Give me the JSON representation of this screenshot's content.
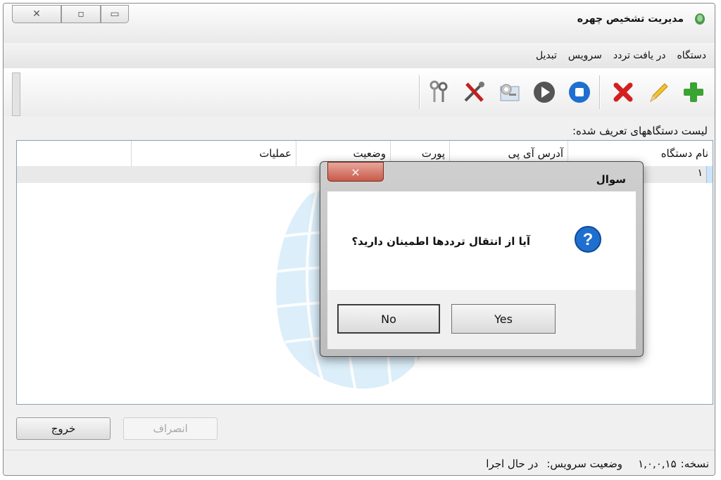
{
  "window": {
    "title": "مدیریت تشخیص چهره"
  },
  "menu": {
    "items": [
      "دستگاه",
      "در یافت تردد",
      "سرویس",
      "تبدیل"
    ]
  },
  "toolbar": {
    "icons": [
      "add-icon",
      "edit-icon",
      "delete-icon",
      "stop-icon",
      "play-icon",
      "settings-icon",
      "tools-icon",
      "keys-icon"
    ]
  },
  "list": {
    "label": "لیست دستگاههای تعریف شده:",
    "columns": [
      "نام دستگاه",
      "آدرس آی پی",
      "پورت",
      "وضعیت",
      "عملیات"
    ],
    "rows": [
      {
        "num": "۱"
      }
    ]
  },
  "buttons": {
    "cancel": "انصراف",
    "exit": "خروج"
  },
  "status": {
    "version_label": "نسخه:",
    "version_value": "۱,۰,۰,۱۵",
    "service_label": "وضعیت سرویس:",
    "service_value": "در حال اجرا"
  },
  "dialog": {
    "title": "سوال",
    "message": "آیا از انتقال ترددها اطمینان دارید؟",
    "yes": "Yes",
    "no": "No",
    "close": "×"
  },
  "colors": {
    "accent_blue": "#1f6fd0",
    "delete_red": "#d41f1f",
    "add_green": "#3aa332"
  }
}
